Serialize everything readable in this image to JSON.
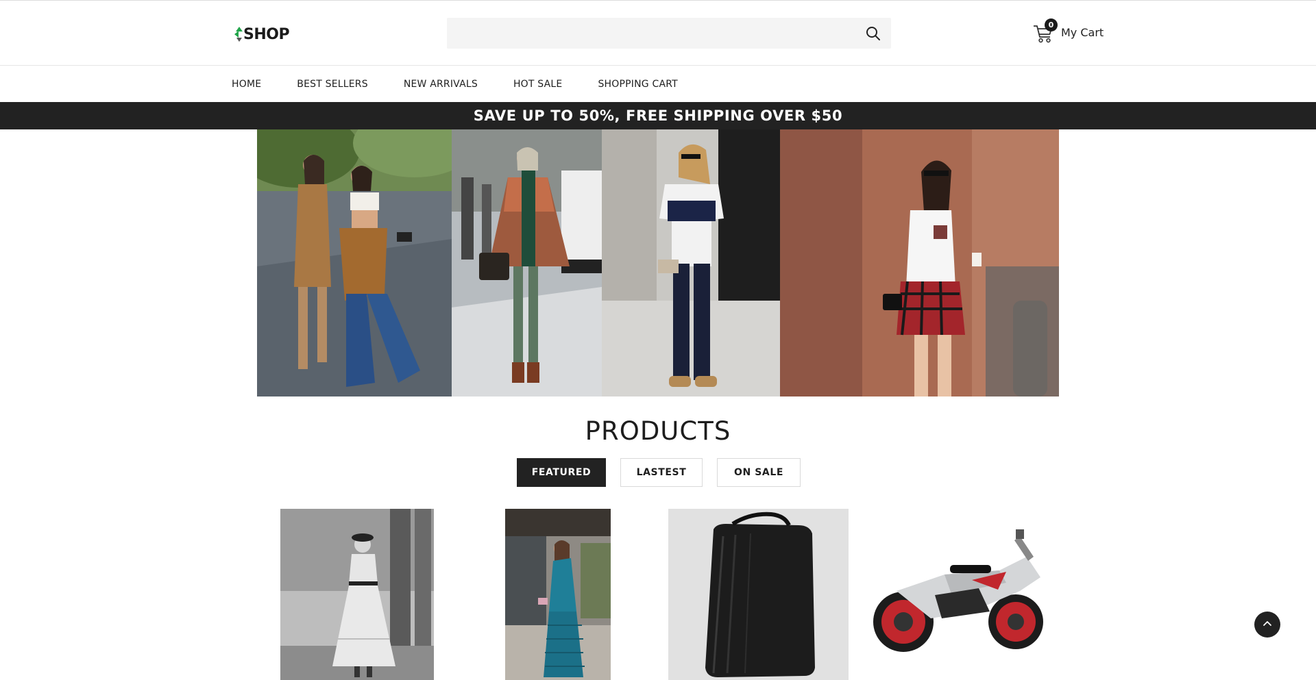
{
  "header": {
    "logo_text": "SHOP",
    "search": {
      "value": "",
      "placeholder": ""
    },
    "cart": {
      "count": "0",
      "label": "My Cart"
    }
  },
  "nav": {
    "items": [
      "HOME",
      "BEST SELLERS",
      "NEW ARRIVALS",
      "HOT SALE",
      "SHOPPING CART"
    ]
  },
  "promo": {
    "text": "SAVE UP TO 50%, FREE SHIPPING OVER $50"
  },
  "products": {
    "title": "PRODUCTS",
    "tabs": [
      "FEATURED",
      "LASTEST",
      "ON SALE"
    ],
    "active_tab": "FEATURED"
  },
  "colors": {
    "accent_dark": "#222222",
    "logo_green": "#22a54a",
    "search_bg": "#f4f4f4"
  },
  "icons": {
    "search": "search-icon",
    "cart": "cart-icon",
    "back_to_top": "chevron-up-icon"
  }
}
